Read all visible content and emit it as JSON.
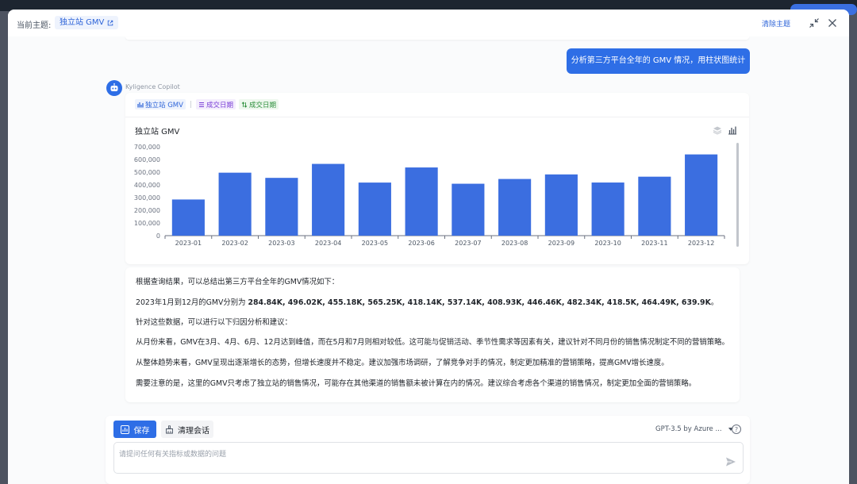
{
  "header": {
    "topic_label": "当前主题:",
    "topic_name": "独立站 GMV",
    "clear_topic": "清除主题"
  },
  "conversation": {
    "user_message": "分析第三方平台全年的 GMV 情况，用柱状图统计",
    "bot_name": "Kyligence Copilot",
    "chips": {
      "metric": "独立站 GMV",
      "dimension": "成交日期",
      "sort": "成交日期"
    }
  },
  "chart_data": {
    "type": "bar",
    "title": "独立站 GMV",
    "categories": [
      "2023-01",
      "2023-02",
      "2023-03",
      "2023-04",
      "2023-05",
      "2023-06",
      "2023-07",
      "2023-08",
      "2023-09",
      "2023-10",
      "2023-11",
      "2023-12"
    ],
    "values": [
      284840,
      496020,
      455180,
      565250,
      418140,
      537140,
      408930,
      446460,
      482340,
      418500,
      464490,
      639900
    ],
    "ylim": [
      0,
      700000
    ],
    "yticks": [
      "0",
      "100,000",
      "200,000",
      "300,000",
      "400,000",
      "500,000",
      "600,000",
      "700,000"
    ],
    "grid": false,
    "bar_color": "#3b6ee0"
  },
  "answer": {
    "intro": "根据查询结果，可以总结出第三方平台全年的GMV情况如下：",
    "values_prefix": "2023年1月到12月的GMV分别为 ",
    "values_bold": "284.84K, 496.02K, 455.18K, 565.25K, 418.14K, 537.14K, 408.93K, 446.46K, 482.34K, 418.5K, 464.49K, 639.9K",
    "values_suffix": "。",
    "analysis_intro": "针对这些数据，可以进行以下归因分析和建议：",
    "point1": "从月份来看，GMV在3月、4月、6月、12月达到峰值，而在5月和7月则相对较低。这可能与促销活动、季节性需求等因素有关，建议针对不同月份的销售情况制定不同的营销策略。",
    "point2": "从整体趋势来看，GMV呈现出逐渐增长的态势，但增长速度并不稳定。建议加强市场调研，了解竞争对手的情况，制定更加精准的营销策略，提高GMV增长速度。",
    "point3": "需要注意的是，这里的GMV只考虑了独立站的销售情况，可能存在其他渠道的销售额未被计算在内的情况。建议综合考虑各个渠道的销售情况，制定更加全面的营销策略。"
  },
  "input": {
    "save_label": "保存",
    "clear_session_label": "清理会话",
    "model_label": "GPT-3.5 by Azure ...",
    "placeholder": "请提问任何有关指标或数据的问题"
  },
  "colors": {
    "accent": "#2e6ee6"
  }
}
